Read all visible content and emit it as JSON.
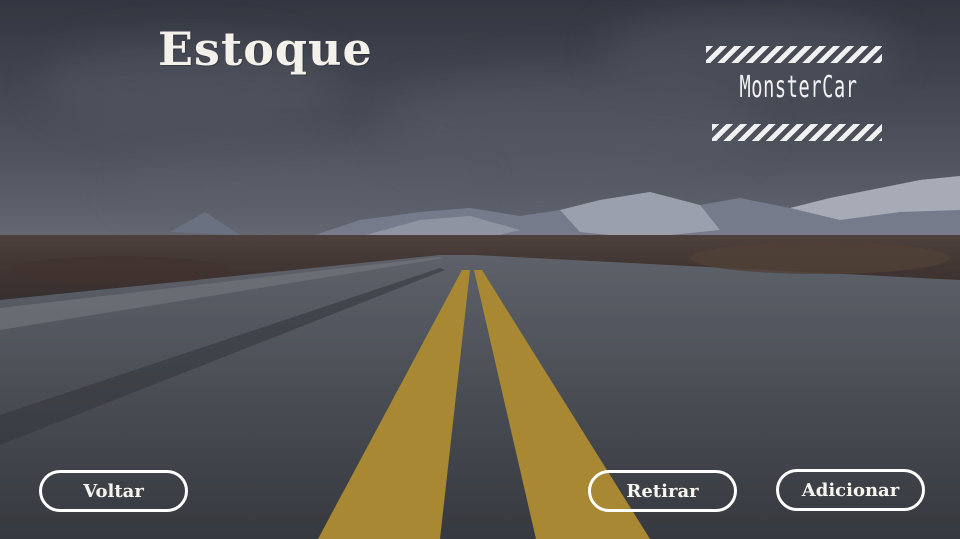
{
  "page": {
    "title": "Estoque"
  },
  "logo": {
    "text": "MonsterCar"
  },
  "actions": {
    "back_label": "Voltar",
    "remove_label": "Retirar",
    "add_label": "Adicionar"
  },
  "colors": {
    "text": "#f4f1ea",
    "button_border": "#ffffff",
    "road_line": "#c9a238"
  }
}
